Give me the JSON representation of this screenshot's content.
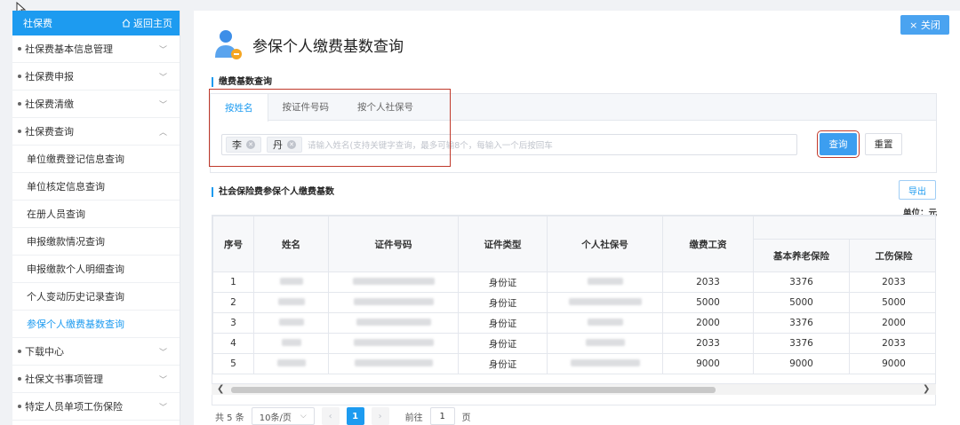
{
  "sidebar": {
    "header_title": "社保费",
    "home_label": "返回主页",
    "items": [
      {
        "label": "社保费基本信息管理"
      },
      {
        "label": "社保费申报"
      },
      {
        "label": "社保费清缴"
      },
      {
        "label": "社保费查询"
      }
    ],
    "sub_items": [
      {
        "label": "单位缴费登记信息查询"
      },
      {
        "label": "单位核定信息查询"
      },
      {
        "label": "在册人员查询"
      },
      {
        "label": "申报缴款情况查询"
      },
      {
        "label": "申报缴款个人明细查询"
      },
      {
        "label": "个人变动历史记录查询"
      },
      {
        "label": "参保个人缴费基数查询"
      }
    ],
    "items_after": [
      {
        "label": "下载中心"
      },
      {
        "label": "社保文书事项管理"
      },
      {
        "label": "特定人员单项工伤保险"
      }
    ]
  },
  "header": {
    "close_label": "× 关闭",
    "page_title": "参保个人缴费基数查询"
  },
  "query": {
    "section_title": "缴费基数查询",
    "tabs": [
      {
        "label": "按姓名"
      },
      {
        "label": "按证件号码"
      },
      {
        "label": "按个人社保号"
      }
    ],
    "tags": [
      {
        "label": "李"
      },
      {
        "label": "丹"
      }
    ],
    "placeholder": "请输入姓名(支持关键字查询，最多可输8个，每输入一个后按回车",
    "query_button": "查询",
    "reset_button": "重置"
  },
  "results": {
    "section_title": "社会保险费参保个人缴费基数",
    "export_label": "导出",
    "unit_label": "单位：元",
    "columns": [
      "序号",
      "姓名",
      "证件号码",
      "证件类型",
      "个人社保号",
      "缴费工资",
      "基本养老保险",
      "工伤保险"
    ],
    "rows": [
      {
        "index": "1",
        "id_type": "身份证",
        "wage": "2033",
        "pension": "3376",
        "injury": "2033"
      },
      {
        "index": "2",
        "id_type": "身份证",
        "wage": "5000",
        "pension": "5000",
        "injury": "5000"
      },
      {
        "index": "3",
        "id_type": "身份证",
        "wage": "2000",
        "pension": "3376",
        "injury": "2000"
      },
      {
        "index": "4",
        "id_type": "身份证",
        "wage": "2033",
        "pension": "3376",
        "injury": "2033"
      },
      {
        "index": "5",
        "id_type": "身份证",
        "wage": "9000",
        "pension": "9000",
        "injury": "9000"
      }
    ]
  },
  "pager": {
    "total": "共 5 条",
    "page_size": "10条/页",
    "current_page": "1",
    "goto_label": "前往",
    "goto_value": "1",
    "page_suffix": "页"
  }
}
